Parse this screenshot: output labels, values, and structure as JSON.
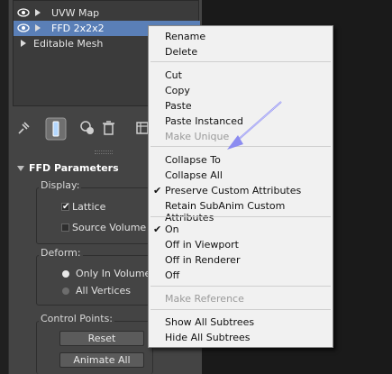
{
  "stack": {
    "items": [
      {
        "label": "UVW Map",
        "selected": false,
        "has_eye": true,
        "has_arrow": true
      },
      {
        "label": "FFD 2x2x2",
        "selected": true,
        "has_eye": true,
        "has_arrow": true
      },
      {
        "label": "Editable Mesh",
        "selected": false,
        "has_eye": false,
        "has_arrow": true
      }
    ]
  },
  "toolbar": {
    "icons": [
      "pin-stack-icon",
      "show-end-result-icon",
      "make-unique-icon",
      "remove-modifier-icon",
      "configure-modifier-sets-icon"
    ]
  },
  "rollout": {
    "title": "FFD Parameters",
    "display": {
      "title": "Display:",
      "lattice": {
        "label": "Lattice",
        "checked": true
      },
      "source_volume": {
        "label": "Source Volume",
        "checked": false
      }
    },
    "deform": {
      "title": "Deform:",
      "only_in_volume": {
        "label": "Only In Volume",
        "selected": true
      },
      "all_vertices": {
        "label": "All Vertices",
        "selected": false
      }
    },
    "control_points": {
      "title": "Control Points:",
      "reset": "Reset",
      "animate_all": "Animate All"
    }
  },
  "context_menu": {
    "items": {
      "rename": "Rename",
      "delete": "Delete",
      "cut": "Cut",
      "copy": "Copy",
      "paste": "Paste",
      "paste_instanced": "Paste Instanced",
      "make_unique": "Make Unique",
      "collapse_to": "Collapse To",
      "collapse_all": "Collapse All",
      "preserve_custom": "Preserve Custom Attributes",
      "retain_subanim": "Retain SubAnim Custom Attributes",
      "on": "On",
      "off_in_viewport": "Off in Viewport",
      "off_in_renderer": "Off in Renderer",
      "off": "Off",
      "make_reference": "Make Reference",
      "show_all_subtrees": "Show All Subtrees",
      "hide_all_subtrees": "Hide All Subtrees"
    },
    "checked": [
      "preserve_custom",
      "on"
    ],
    "disabled": [
      "make_unique",
      "make_reference"
    ]
  },
  "colors": {
    "panel_bg": "#444444",
    "selection": "#5a7fb7",
    "menu_bg": "#f1f1f1",
    "annotation_arrow": "#8c8cf0"
  }
}
